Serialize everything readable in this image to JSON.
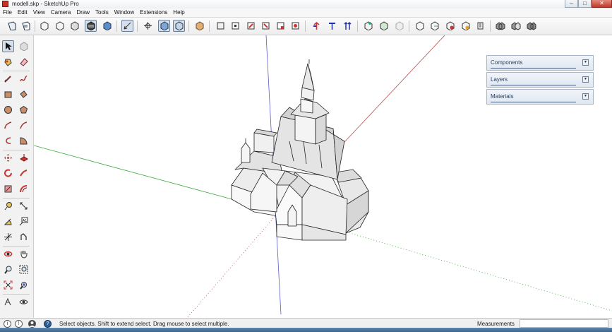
{
  "window": {
    "title": "modell.skp - SketchUp Pro",
    "controls": [
      "–",
      "□",
      "✕"
    ]
  },
  "menu": [
    "File",
    "Edit",
    "View",
    "Camera",
    "Draw",
    "Tools",
    "Window",
    "Extensions",
    "Help"
  ],
  "trays": [
    {
      "label": "Components"
    },
    {
      "label": "Layers"
    },
    {
      "label": "Materials"
    }
  ],
  "statusbar": {
    "icons": [
      "i",
      "!",
      "person",
      "?"
    ],
    "message": "Select objects. Shift to extend select. Drag mouse to select multiple.",
    "measurements_label": "Measurements",
    "measurements_value": ""
  },
  "colors": {
    "toolbar_bg": "#ededed",
    "tray_bg": "#dfe7f1",
    "axis_red": "#b05050",
    "axis_green": "#3aa83a",
    "axis_blue": "#5a5ad0"
  }
}
